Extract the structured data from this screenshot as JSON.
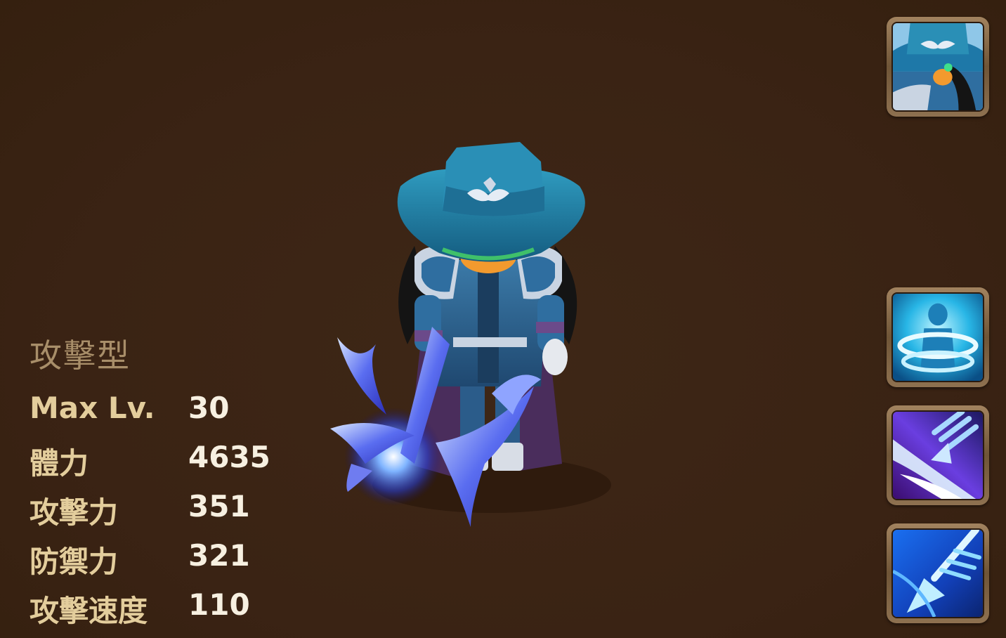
{
  "monster": {
    "type_label": "攻擊型",
    "stats": [
      {
        "name": "Max Lv.",
        "value": "30"
      },
      {
        "name": "體力",
        "value": "4635"
      },
      {
        "name": "攻擊力",
        "value": "351"
      },
      {
        "name": "防禦力",
        "value": "321"
      },
      {
        "name": "攻擊速度",
        "value": "110"
      }
    ]
  },
  "side_buttons": [
    {
      "icon": "portrait-icon"
    },
    {
      "icon": "skill-1-icon"
    },
    {
      "icon": "skill-2-icon"
    },
    {
      "icon": "skill-3-icon"
    }
  ],
  "colors": {
    "background": "#3a2314",
    "type_label": "#a88e69",
    "stat_name": "#e3cd9c",
    "stat_value": "#f7f0e1",
    "frame": "#8e7150"
  }
}
